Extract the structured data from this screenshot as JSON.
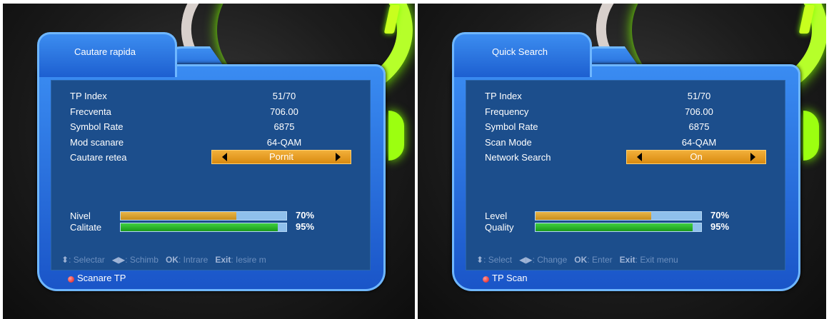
{
  "screens": [
    {
      "title": "Cautare rapida",
      "rows": [
        {
          "label": "TP Index",
          "value": "51/70"
        },
        {
          "label": "Frecventa",
          "value": "706.00"
        },
        {
          "label": "Symbol Rate",
          "value": "6875"
        },
        {
          "label": "Mod scanare",
          "value": "64-QAM"
        },
        {
          "label": "Cautare retea",
          "value": "Pornit"
        }
      ],
      "level": {
        "label": "Nivel",
        "value_text": "70%",
        "percent": 70
      },
      "quality": {
        "label": "Calitate",
        "value_text": "95%",
        "percent": 95
      },
      "help": {
        "select": ": Selectar",
        "change": ": Schimb",
        "ok_key": "OK",
        "ok": ": Intrare",
        "exit_key": "Exit",
        "exit": ": Iesire m"
      },
      "footer": "Scanare TP"
    },
    {
      "title": "Quick Search",
      "rows": [
        {
          "label": "TP Index",
          "value": "51/70"
        },
        {
          "label": "Frequency",
          "value": "706.00"
        },
        {
          "label": "Symbol Rate",
          "value": "6875"
        },
        {
          "label": "Scan Mode",
          "value": "64-QAM"
        },
        {
          "label": "Network Search",
          "value": "On"
        }
      ],
      "level": {
        "label": "Level",
        "value_text": "70%",
        "percent": 70
      },
      "quality": {
        "label": "Quality",
        "value_text": "95%",
        "percent": 95
      },
      "help": {
        "select": ": Select",
        "change": ": Change",
        "ok_key": "OK",
        "ok": ": Enter",
        "exit_key": "Exit",
        "exit": ": Exit menu"
      },
      "footer": "TP Scan"
    }
  ],
  "colors": {
    "dialog_blue": "#2a74e0",
    "panel_blue": "#1c4e8c",
    "selector_orange": "#e69a20",
    "level_bar": "#d9a030",
    "quality_bar": "#2fba2f",
    "bar_track": "#8fc0ec",
    "record_dot": "#e01010"
  },
  "icons": [
    "up-down-arrows-icon",
    "left-right-arrows-icon",
    "record-dot-icon",
    "left-arrow-icon",
    "right-arrow-icon"
  ]
}
